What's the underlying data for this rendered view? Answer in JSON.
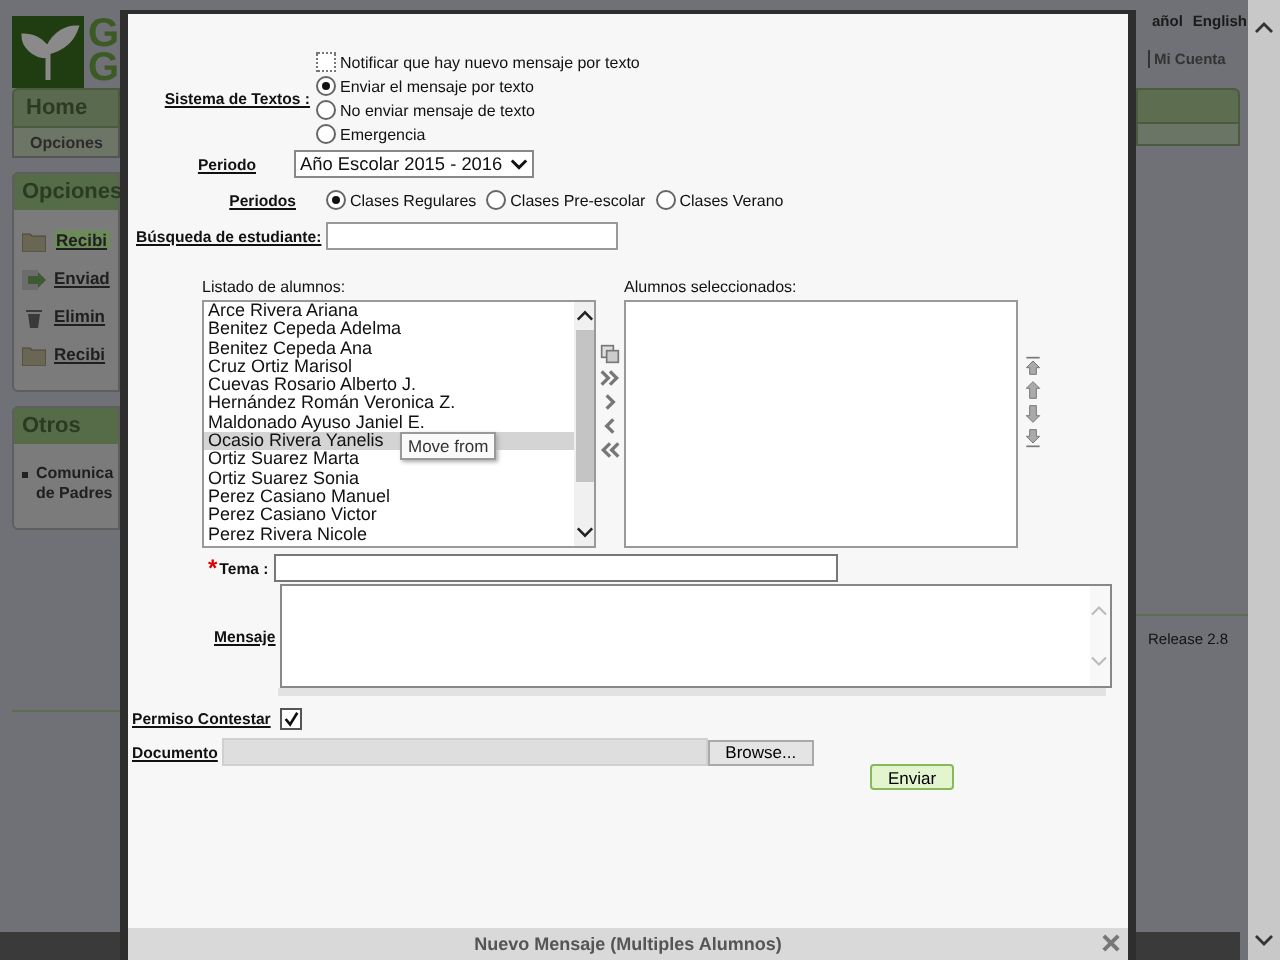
{
  "background_page": {
    "logo_letters": [
      "G",
      "G"
    ],
    "nav_tab": "Home",
    "subnav_item": "Opciones",
    "language_links": [
      "añol",
      "English"
    ],
    "account_link": "Mi Cuenta",
    "sidebar_panels": [
      {
        "title": "Opciones",
        "items": [
          {
            "label": "Recibi",
            "kind": "folder",
            "selected": true
          },
          {
            "label": "Enviad",
            "kind": "send",
            "selected": false
          },
          {
            "label": "Elimin",
            "kind": "trash",
            "selected": false
          },
          {
            "label": "Recibi",
            "kind": "folder",
            "selected": false
          }
        ]
      },
      {
        "title": "Otros",
        "items": [
          {
            "label": "Comunica de Padres",
            "kind": "bullet",
            "selected": false
          }
        ]
      }
    ],
    "release": "Release 2.8"
  },
  "dialog": {
    "title": "Nuevo Mensaje (Multiples Alumnos)",
    "text_system": {
      "label": "Sistema de Textos :",
      "notify": {
        "label": "Notificar que hay nuevo mensaje por texto",
        "checked": false
      },
      "options": [
        {
          "label": "Enviar el mensaje por texto",
          "selected": true
        },
        {
          "label": "No enviar mensaje de texto",
          "selected": false
        },
        {
          "label": "Emergencia",
          "selected": false
        }
      ]
    },
    "period": {
      "label": "Periodo",
      "value": "Año Escolar 2015 - 2016"
    },
    "periods": {
      "label": "Periodos",
      "options": [
        {
          "label": "Clases Regulares",
          "selected": true
        },
        {
          "label": "Clases Pre-escolar",
          "selected": false
        },
        {
          "label": "Clases Verano",
          "selected": false
        }
      ]
    },
    "search": {
      "label": "Búsqueda de estudiante:"
    },
    "students": {
      "label": "Listado de alumnos:",
      "items": [
        {
          "name": "Arce Rivera Ariana",
          "selected": false
        },
        {
          "name": "Benitez Cepeda Adelma",
          "selected": false
        },
        {
          "name": "Benitez Cepeda Ana",
          "selected": false
        },
        {
          "name": "Cruz Ortiz Marisol",
          "selected": false
        },
        {
          "name": "Cuevas Rosario Alberto J.",
          "selected": false
        },
        {
          "name": "Hernández Román Veronica Z.",
          "selected": false
        },
        {
          "name": "Maldonado Ayuso Janiel E.",
          "selected": false
        },
        {
          "name": "Ocasio Rivera Yanelis",
          "selected": true
        },
        {
          "name": "Ortiz Suarez Marta",
          "selected": false
        },
        {
          "name": "Ortiz Suarez Sonia",
          "selected": false
        },
        {
          "name": "Perez Casiano Manuel",
          "selected": false
        },
        {
          "name": "Perez Casiano Victor",
          "selected": false
        },
        {
          "name": "Perez Rivera Nicole",
          "selected": false
        }
      ],
      "tooltip": "Move from"
    },
    "selected_students": {
      "label": "Alumnos seleccionados:"
    },
    "subject": {
      "label": "Tema :",
      "required_mark": "*"
    },
    "message": {
      "label": "Mensaje"
    },
    "reply_permission": {
      "label": "Permiso Contestar",
      "checked": true
    },
    "document": {
      "label": "Documento",
      "button": "Browse..."
    },
    "submit": "Enviar"
  }
}
